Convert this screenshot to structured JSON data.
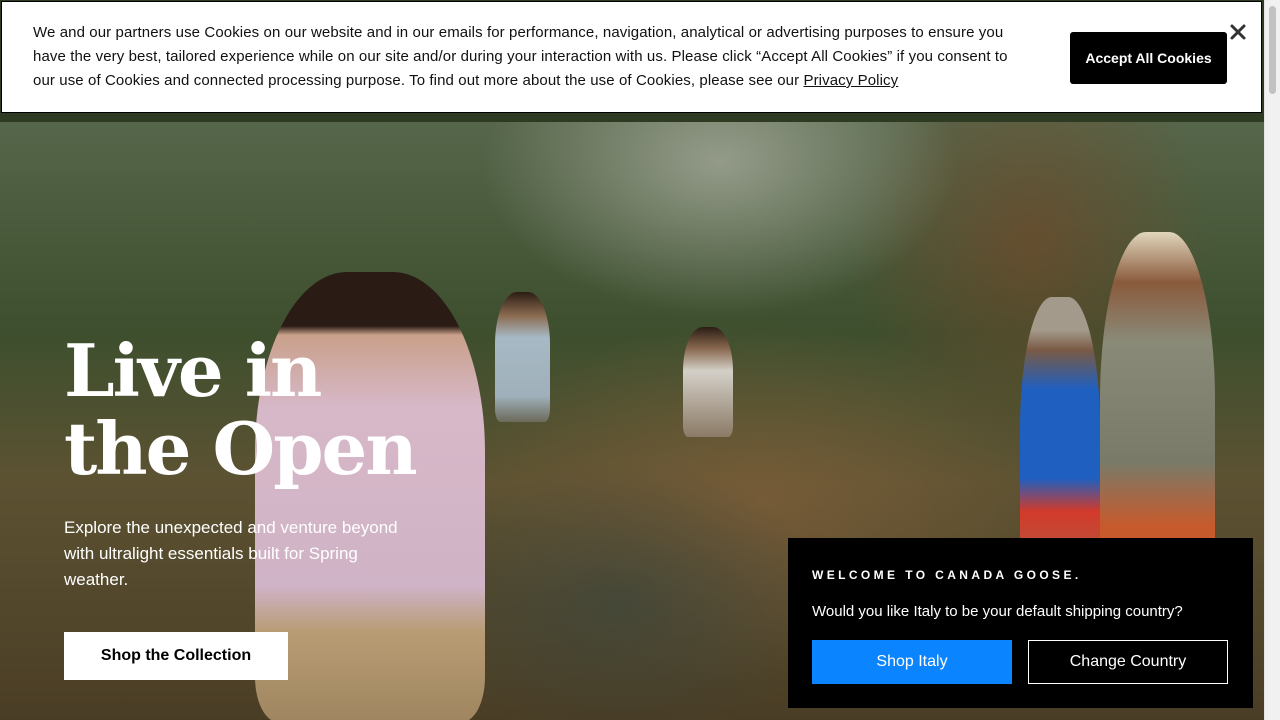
{
  "cookie_banner": {
    "text": "We and our partners use Cookies on our website and in our emails for performance, navigation, analytical or advertising purposes to ensure you have the very best, tailored experience while on our site and/or during your interaction with us. Please click “Accept All Cookies” if you consent to our use of Cookies and connected processing purpose. To find out more about the use of Cookies, please see our ",
    "privacy_link": "Privacy Policy",
    "accept_label": "Accept All Cookies",
    "close_icon": "close-icon"
  },
  "hero": {
    "title": "Live in the Open",
    "subtitle": "Explore the unexpected and venture beyond with ultralight essentials built for Spring weather.",
    "cta_label": "Shop the Collection"
  },
  "welcome_popup": {
    "title": "WELCOME TO CANADA GOOSE.",
    "question": "Would you like Italy to be your default shipping country?",
    "primary_label": "Shop Italy",
    "secondary_label": "Change Country",
    "primary_color": "#0a84ff"
  }
}
